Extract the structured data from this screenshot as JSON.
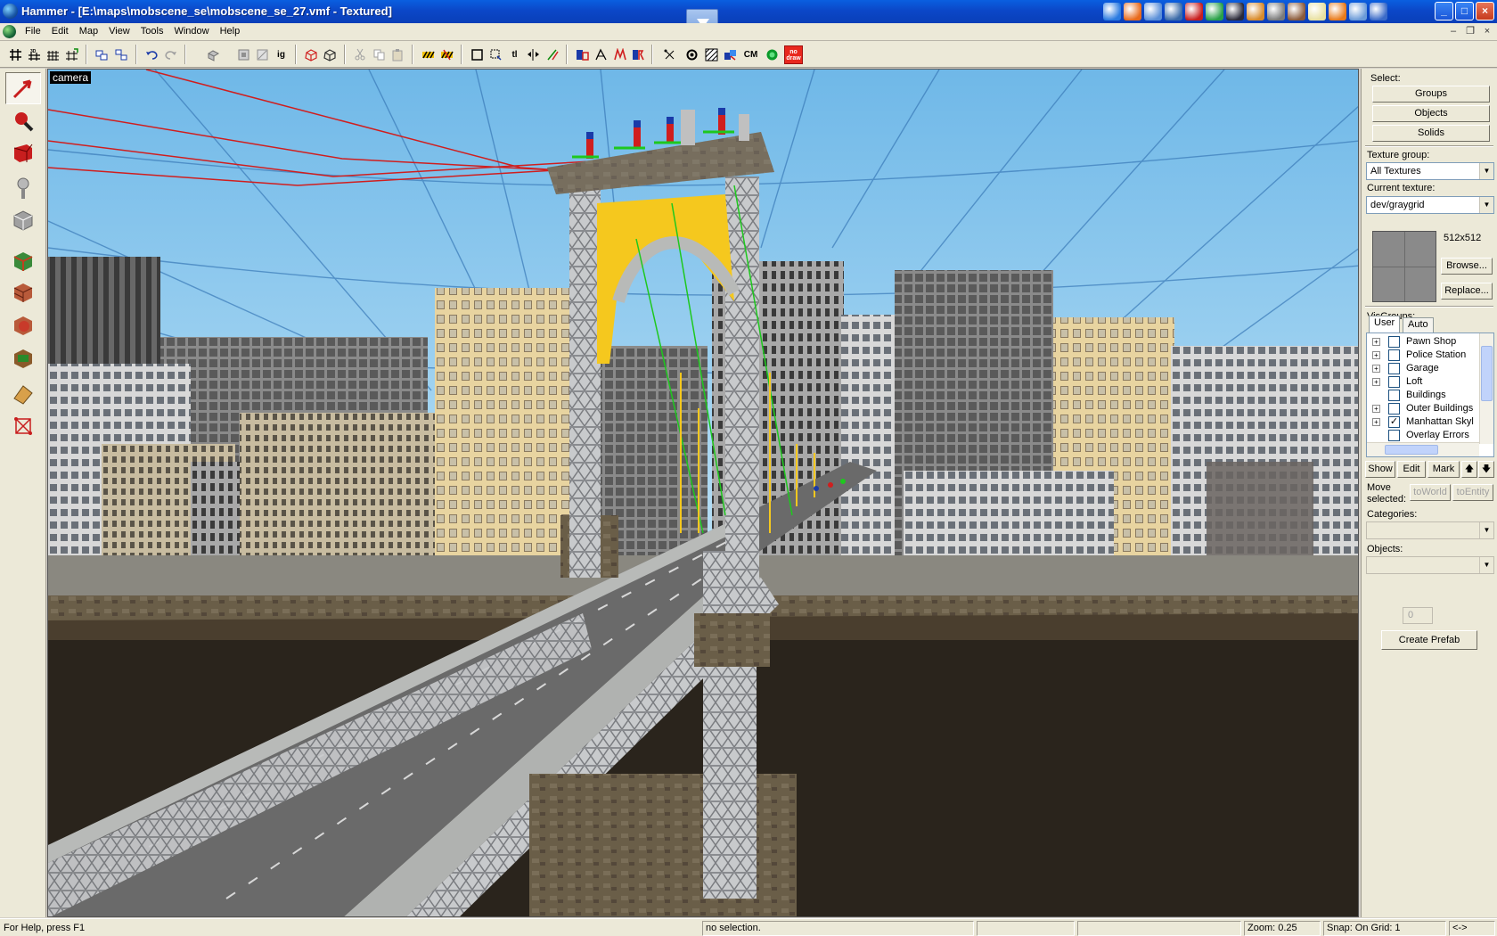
{
  "window": {
    "title": "Hammer - [E:\\maps\\mobscene_se\\mobscene_se_27.vmf - Textured]",
    "controls": {
      "minimize": "_",
      "maximize": "□",
      "close": "×"
    },
    "mdi_controls": {
      "minimize": "–",
      "restore": "❐",
      "close": "×"
    }
  },
  "quick_launch": [
    {
      "icon": "internet-explorer-icon",
      "color": "#2a7ae0"
    },
    {
      "icon": "firefox-icon",
      "color": "#e86a1c"
    },
    {
      "icon": "messenger-icon",
      "color": "#5a8fd8"
    },
    {
      "icon": "python-icon",
      "color": "#3a6aa8"
    },
    {
      "icon": "filezilla-icon",
      "color": "#c81e1e"
    },
    {
      "icon": "globe-icon",
      "color": "#28a048"
    },
    {
      "icon": "steam-icon",
      "color": "#2a2a3a"
    },
    {
      "icon": "paint-icon",
      "color": "#d88a2a"
    },
    {
      "icon": "cat-icon",
      "color": "#7a7a7a"
    },
    {
      "icon": "tools-icon",
      "color": "#8a5a3a"
    },
    {
      "icon": "notepad-icon",
      "color": "#e8e0a0"
    },
    {
      "icon": "cone-icon",
      "color": "#e87a1a"
    },
    {
      "icon": "document-icon",
      "color": "#6a9ad8"
    },
    {
      "icon": "book-icon",
      "color": "#3a6ac8"
    }
  ],
  "menu": [
    "File",
    "Edit",
    "Map",
    "View",
    "Tools",
    "Window",
    "Help"
  ],
  "toolbar": {
    "ignore_groups_label": "ig",
    "texture_lock_label": "tl",
    "cordon_label": "CM",
    "nodraw_line1": "no",
    "nodraw_line2": "draw"
  },
  "left_tools": [
    {
      "name": "selection-tool",
      "icon": "arrow-icon",
      "color": "#c81e1e"
    },
    {
      "name": "magnify-tool",
      "icon": "magnifier-icon",
      "color": "#c81e1e"
    },
    {
      "name": "camera-tool",
      "icon": "camera-icon",
      "color": "#c81e1e"
    },
    {
      "name": "entity-tool",
      "icon": "lamp-icon",
      "color": "#b8b8b8"
    },
    {
      "name": "block-tool",
      "icon": "cube-icon",
      "color": "#a0a0a0"
    },
    {
      "name": "texture-application-tool",
      "icon": "texture-cube-icon",
      "color": "#3a8a3a"
    },
    {
      "name": "apply-texture-tool",
      "icon": "brick-cube-icon",
      "color": "#b85a3a"
    },
    {
      "name": "decal-tool",
      "icon": "decal-cube-icon",
      "color": "#c83a2a"
    },
    {
      "name": "overlay-tool",
      "icon": "overlay-cube-icon",
      "color": "#8a5a2a"
    },
    {
      "name": "clipping-tool",
      "icon": "clip-icon",
      "color": "#d8a04a"
    },
    {
      "name": "vertex-tool",
      "icon": "vertex-icon",
      "color": "#c81e1e"
    }
  ],
  "viewport": {
    "label": "camera"
  },
  "right_panel": {
    "select_label": "Select:",
    "groups_button": "Groups",
    "objects_button": "Objects",
    "solids_button": "Solids",
    "texture_group_label": "Texture group:",
    "texture_group_value": "All Textures",
    "current_texture_label": "Current texture:",
    "current_texture_value": "dev/graygrid",
    "texture_size": "512x512",
    "browse_button": "Browse...",
    "replace_button": "Replace...",
    "visgroups_label": "VisGroups:",
    "tabs": [
      "User",
      "Auto"
    ],
    "visgroups": [
      {
        "label": "Pawn Shop",
        "expandable": true,
        "checked": false
      },
      {
        "label": "Police Station",
        "expandable": true,
        "checked": false
      },
      {
        "label": "Garage",
        "expandable": true,
        "checked": false
      },
      {
        "label": "Loft",
        "expandable": true,
        "checked": false
      },
      {
        "label": "Buildings",
        "expandable": false,
        "checked": false
      },
      {
        "label": "Outer Buildings",
        "expandable": true,
        "checked": false
      },
      {
        "label": "Manhattan Skyl",
        "expandable": true,
        "checked": true
      },
      {
        "label": "Overlay Errors",
        "expandable": false,
        "checked": false
      }
    ],
    "show_button": "Show",
    "edit_button": "Edit",
    "mark_button": "Mark",
    "up_button": "🡅",
    "down_button": "🡇",
    "move_selected_line1": "Move",
    "move_selected_line2": "selected:",
    "to_world_button": "toWorld",
    "to_entity_button": "toEntity",
    "categories_label": "Categories:",
    "objects_label": "Objects:",
    "count_value": "0",
    "create_prefab_button": "Create Prefab"
  },
  "status": {
    "help": "For Help, press F1",
    "selection": "no selection.",
    "zoom": "Zoom: 0.25",
    "snap": "Snap: On Grid: 1",
    "extra": "<->"
  }
}
